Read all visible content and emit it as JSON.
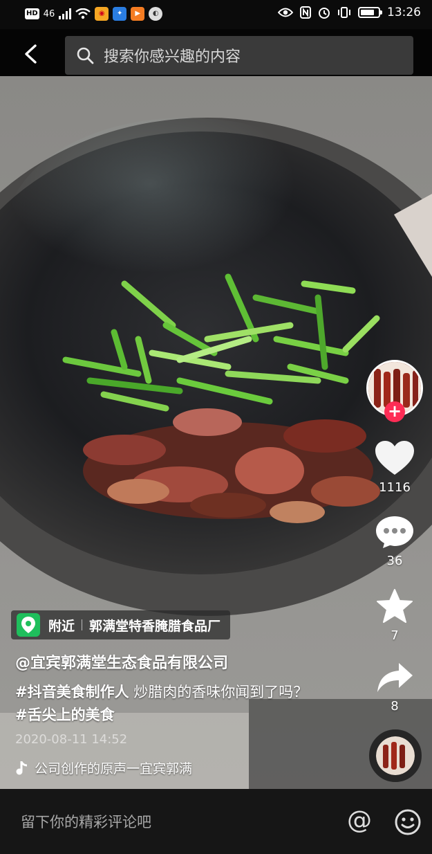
{
  "status_bar": {
    "left_badges": [
      "HD",
      "46"
    ],
    "time": "13:26",
    "battery_level": 0.8
  },
  "top_bar": {
    "back_icon": "chevron-left-icon",
    "search_placeholder": "搜索你感兴趣的内容"
  },
  "actions": {
    "like_count": "1116",
    "comment_count": "36",
    "favorite_count": "7",
    "share_count": "8"
  },
  "poi": {
    "nearby_label": "附近",
    "place_name": "郭满堂特香腌腊食品厂"
  },
  "caption": {
    "author": "@宜宾郭满堂生态食品有限公司",
    "tag1": "#抖音美食制作人",
    "text": " 炒腊肉的香味你闻到了吗？",
    "tag2": "#舌尖上的美食",
    "date": "2020-08-11 14:52",
    "music": "公司创作的原声一宜宾郭满"
  },
  "comment_bar": {
    "placeholder": "留下你的精彩评论吧",
    "at_symbol": "@"
  },
  "colors": {
    "accent": "#fe2c55",
    "poi_green": "#1fbf5c"
  }
}
